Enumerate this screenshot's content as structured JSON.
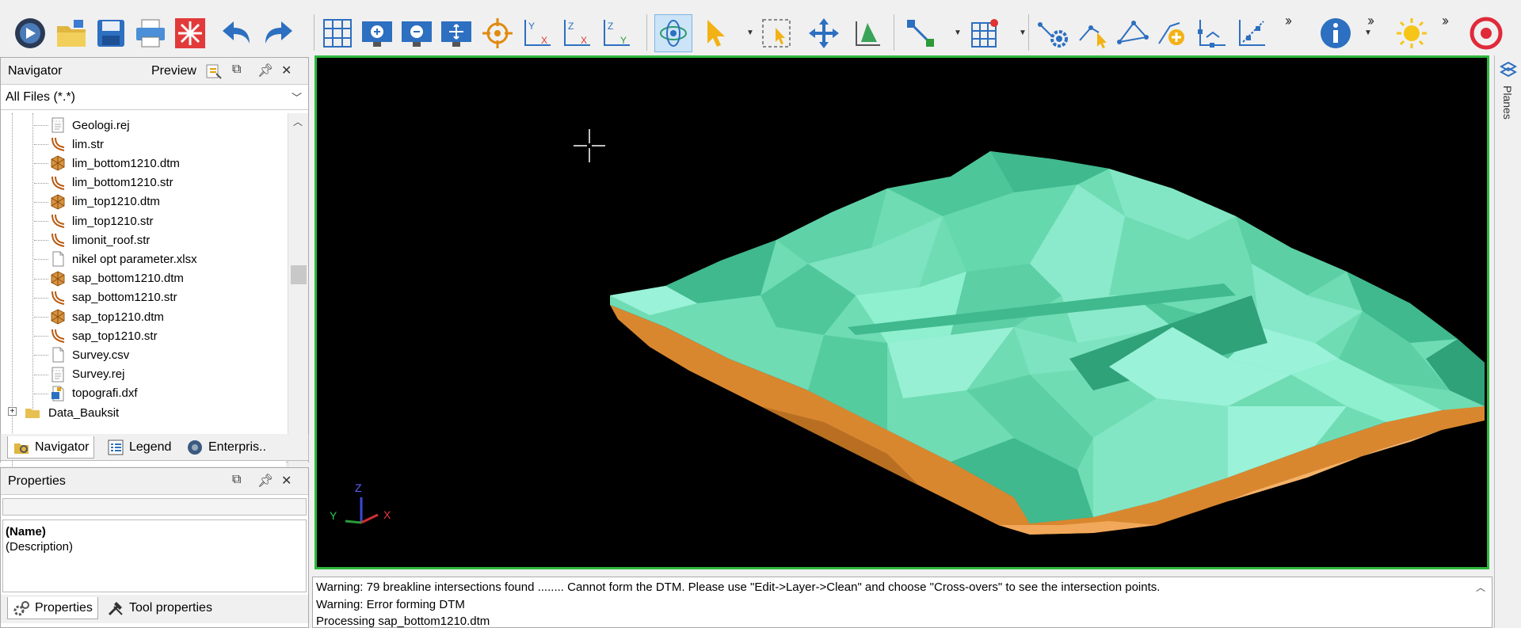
{
  "navigator": {
    "title": "Navigator",
    "preview_label": "Preview",
    "filter_value": "All Files (*.*)",
    "files": [
      {
        "name": "Geologi.rej",
        "type": "rej"
      },
      {
        "name": "lim.str",
        "type": "str"
      },
      {
        "name": "lim_bottom1210.dtm",
        "type": "dtm"
      },
      {
        "name": "lim_bottom1210.str",
        "type": "str"
      },
      {
        "name": "lim_top1210.dtm",
        "type": "dtm"
      },
      {
        "name": "lim_top1210.str",
        "type": "str"
      },
      {
        "name": "limonit_roof.str",
        "type": "str"
      },
      {
        "name": "nikel opt parameter.xlsx",
        "type": "doc"
      },
      {
        "name": "sap_bottom1210.dtm",
        "type": "dtm"
      },
      {
        "name": "sap_bottom1210.str",
        "type": "str"
      },
      {
        "name": "sap_top1210.dtm",
        "type": "dtm"
      },
      {
        "name": "sap_top1210.str",
        "type": "str"
      },
      {
        "name": "Survey.csv",
        "type": "doc"
      },
      {
        "name": "Survey.rej",
        "type": "rej"
      },
      {
        "name": "topografi.dxf",
        "type": "dxf"
      }
    ],
    "folder": "Data_Bauksit",
    "tabs": [
      "Navigator",
      "Legend",
      "Enterpris.."
    ]
  },
  "properties": {
    "title": "Properties",
    "name_label": "(Name)",
    "description_label": "(Description)",
    "tabs": [
      "Properties",
      "Tool properties"
    ]
  },
  "viewport": {
    "axis_z": "Z",
    "axis_y": "Y",
    "axis_x": "X",
    "frame_color": "#2db83d",
    "top_surface_color": "#6fdcb4",
    "bottom_surface_color": "#d9872f"
  },
  "planes_tab": "Planes",
  "toolbar_icons": [
    "view-icon",
    "open-folder-icon",
    "save-icon",
    "print-icon",
    "sparkle-icon",
    "undo-icon",
    "redo-icon",
    "grid-icon",
    "zoom-in-icon",
    "zoom-out-icon",
    "zoom-fit-icon",
    "target-icon",
    "plane-yx-icon",
    "plane-zx-icon",
    "plane-zy-icon",
    "rotate-icon",
    "select-arrow-icon",
    "select-box-icon",
    "pan-icon",
    "plane-icon",
    "snap-icon",
    "grid-point-icon",
    "settings-icon",
    "edit-point-icon",
    "triangle-icon",
    "add-point-icon",
    "axis-icon",
    "slope-icon",
    "info-icon",
    "sun-icon",
    "target-ring-icon"
  ],
  "log": {
    "lines": [
      "Warning: 79 breakline intersections found ........ Cannot form the DTM. Please use \"Edit->Layer->Clean\" and choose \"Cross-overs\" to see the intersection points.",
      "Warning: Error forming DTM",
      "Processing sap_bottom1210.dtm"
    ]
  }
}
